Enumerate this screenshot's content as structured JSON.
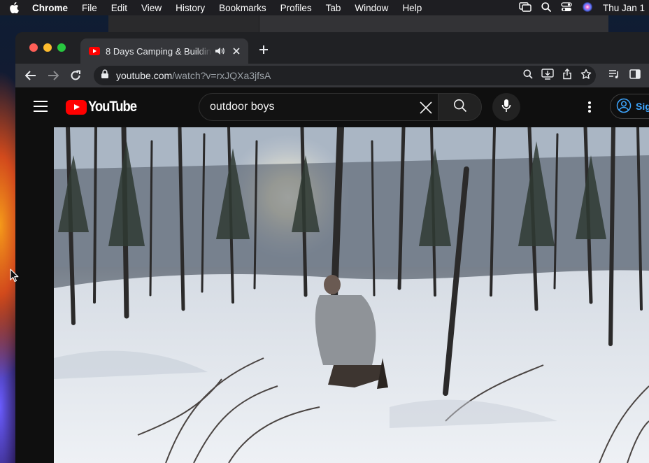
{
  "menubar": {
    "app_name": "Chrome",
    "items": [
      "File",
      "Edit",
      "View",
      "History",
      "Bookmarks",
      "Profiles",
      "Tab",
      "Window",
      "Help"
    ],
    "clock": "Thu Jan 1"
  },
  "browser": {
    "tab_title": "8 Days Camping & Building",
    "address_host": "youtube.com",
    "address_path": "/watch?v=rxJQXa3jfsA"
  },
  "youtube": {
    "logo_text": "YouTube",
    "search_query": "outdoor boys",
    "signin_label": "Sig"
  },
  "colors": {
    "youtube_red": "#ff0000",
    "link_blue": "#3ea6ff",
    "traffic_red": "#ff5f57",
    "traffic_yellow": "#febc2e",
    "traffic_green": "#28c840"
  }
}
